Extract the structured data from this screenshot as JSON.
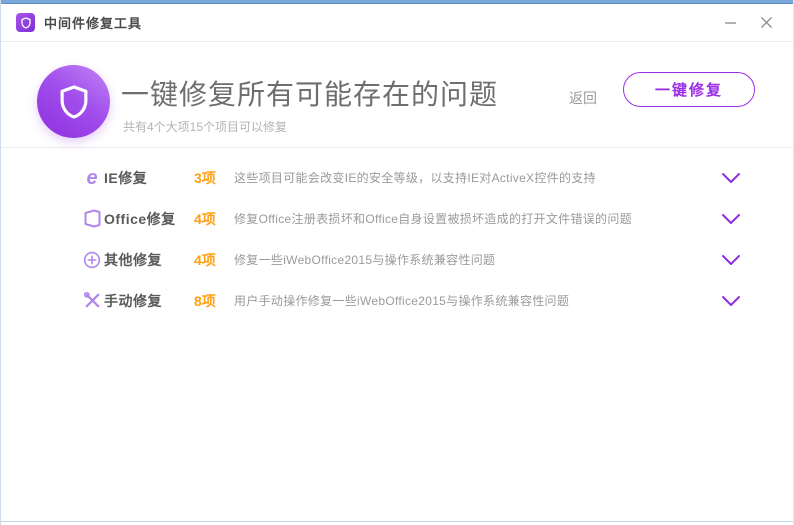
{
  "window": {
    "title": "中间件修复工具"
  },
  "header": {
    "title": "一键修复所有可能存在的问题",
    "subtitle": "共有4个大项15个项目可以修复",
    "back_label": "返回",
    "repair_button_label": "一键修复"
  },
  "colors": {
    "accent_purple": "#9b2fe8",
    "icon_purple": "#b287ec",
    "count_orange": "#ffa014",
    "title_gray": "#6e6e6e",
    "desc_gray": "#9a9a9a",
    "top_border_blue": "#78a7d8"
  },
  "rows": [
    {
      "icon": "ie-icon",
      "label": "IE修复",
      "count": "3项",
      "desc": "这些项目可能会改变IE的安全等级，以支持IE对ActiveX控件的支持"
    },
    {
      "icon": "office-icon",
      "label": "Office修复",
      "count": "4项",
      "desc": "修复Office注册表损坏和Office自身设置被损坏造成的打开文件错误的问题"
    },
    {
      "icon": "circle-plus-icon",
      "label": "其他修复",
      "count": "4项",
      "desc": "修复一些iWebOffice2015与操作系统兼容性问题"
    },
    {
      "icon": "tools-icon",
      "label": "手动修复",
      "count": "8项",
      "desc": "用户手动操作修复一些iWebOffice2015与操作系统兼容性问题"
    }
  ]
}
